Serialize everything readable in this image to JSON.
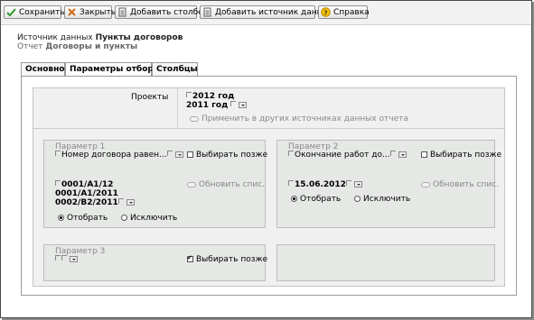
{
  "toolbar": {
    "save": "Сохранить",
    "close": "Закрыть",
    "add_column": "Добавить столбец",
    "add_source": "Добавить источник данных",
    "help": "Справка"
  },
  "header": {
    "source_label": "Источник данных",
    "source_name": "Пункты договоров",
    "report_label": "Отчет",
    "report_name": "Договоры и пункты"
  },
  "tabs": [
    {
      "label": "Основное",
      "active": false
    },
    {
      "label": "Параметры отбора",
      "active": true
    },
    {
      "label": "Столбцы",
      "active": false
    }
  ],
  "projects": {
    "label": "Проекты",
    "values": [
      "2012 год",
      "2011 год"
    ],
    "apply_label": "Применить в других источниках данных отчета"
  },
  "param1": {
    "title": "Параметр 1",
    "field": "Номер договора равен...",
    "choose_later": "Выбирать позже",
    "values": [
      "0001/A1/12",
      "0001/A1/2011",
      "0002/B2/2011"
    ],
    "refresh": "Обновить спис.",
    "select": "Отобрать",
    "exclude": "Исключить"
  },
  "param2": {
    "title": "Параметр 2",
    "field": "Окончание работ до...",
    "choose_later": "Выбирать позже",
    "value": "15.06.2012",
    "refresh": "Обновить спис.",
    "select": "Отобрать",
    "exclude": "Исключить"
  },
  "param3": {
    "title": "Параметр 3",
    "choose_later": "Выбирать позже",
    "choose_later_checked": true
  }
}
